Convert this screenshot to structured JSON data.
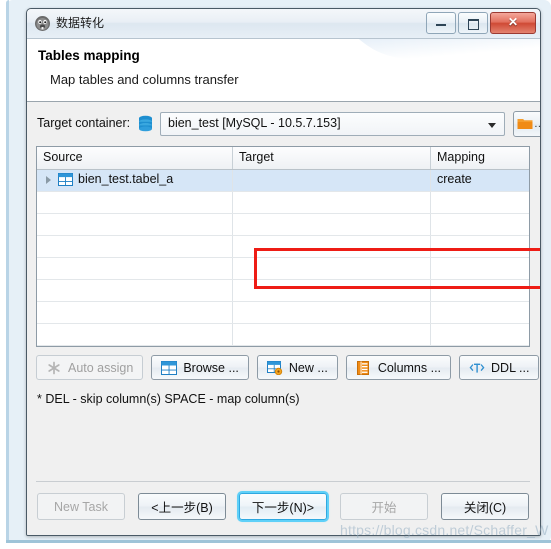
{
  "window": {
    "title": "数据转化",
    "icon": "beaver-icon",
    "controls": {
      "minimize": "minimize-icon",
      "maximize": "maximize-icon",
      "close": "✕"
    }
  },
  "header": {
    "title": "Tables mapping",
    "subtitle": "Map tables and columns transfer"
  },
  "target_container": {
    "label": "Target container:",
    "icon": "database-icon",
    "value": "bien_test  [MySQL - 10.5.7.153]",
    "browse_label": "...",
    "browse_icon": "folder-icon"
  },
  "grid": {
    "columns": [
      "Source",
      "Target",
      "Mapping"
    ],
    "rows": [
      {
        "source": "bien_test.tabel_a",
        "target": "",
        "mapping": "create",
        "selected": true,
        "icon": "table-icon",
        "expandable": true
      },
      {
        "source": "",
        "target": "",
        "mapping": ""
      },
      {
        "source": "",
        "target": "",
        "mapping": ""
      },
      {
        "source": "",
        "target": "",
        "mapping": ""
      },
      {
        "source": "",
        "target": "",
        "mapping": ""
      },
      {
        "source": "",
        "target": "",
        "mapping": ""
      },
      {
        "source": "",
        "target": "",
        "mapping": ""
      },
      {
        "source": "",
        "target": "",
        "mapping": ""
      },
      {
        "source": "",
        "target": "",
        "mapping": ""
      }
    ],
    "highlight_color": "#ee1c15"
  },
  "actions": [
    {
      "label": "Auto assign",
      "icon": "asterisk-icon",
      "disabled": true
    },
    {
      "label": "Browse ...",
      "icon": "table-blue-icon",
      "disabled": false
    },
    {
      "label": "New ...",
      "icon": "table-new-icon",
      "disabled": false
    },
    {
      "label": "Columns ...",
      "icon": "columns-orange-icon",
      "disabled": false
    },
    {
      "label": "DDL ...",
      "icon": "ddl-icon",
      "disabled": false
    }
  ],
  "hint": "* DEL - skip column(s)  SPACE - map column(s)",
  "footer": [
    {
      "label": "New Task",
      "disabled": true,
      "focused": false
    },
    {
      "label": "<上一步(B)",
      "disabled": false,
      "focused": false
    },
    {
      "label": "下一步(N)>",
      "disabled": false,
      "focused": true
    },
    {
      "label": "开始",
      "disabled": true,
      "focused": false
    },
    {
      "label": "关闭(C)",
      "disabled": false,
      "focused": false
    }
  ],
  "watermark": "https://blog.csdn.net/Schaffer_W"
}
